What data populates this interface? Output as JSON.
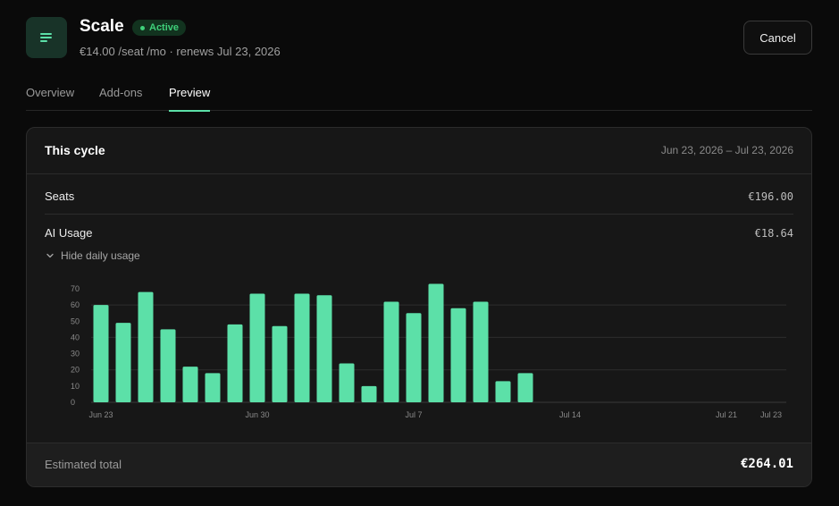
{
  "header": {
    "plan_name": "Scale",
    "status": "Active",
    "subtitle": "€14.00 /seat /mo · renews Jul 23, 2026",
    "cancel_label": "Cancel",
    "icon": "list-lines-icon"
  },
  "tabs": [
    {
      "label": "Overview",
      "active": false
    },
    {
      "label": "Add-ons",
      "active": false
    },
    {
      "label": "Preview",
      "active": true
    }
  ],
  "cycle": {
    "title": "This cycle",
    "range": "Jun 23, 2026 – Jul 23, 2026",
    "rows": [
      {
        "label": "Seats",
        "value": "€196.00"
      },
      {
        "label": "AI Usage",
        "value": "€18.64"
      }
    ],
    "toggle_label": "Hide daily usage",
    "estimated_label": "Estimated total",
    "estimated_value": "€264.01"
  },
  "colors": {
    "accent": "#5ce0a8",
    "badge_bg": "#12331f",
    "badge_text": "#3fd07a",
    "card_bg": "#171717"
  },
  "chart_data": {
    "type": "bar",
    "x_tick_labels": [
      "Jun 23",
      "Jun 30",
      "Jul 7",
      "Jul 14",
      "Jul 21",
      "Jul 23"
    ],
    "y_ticks": [
      0,
      10,
      20,
      30,
      40,
      50,
      60,
      70
    ],
    "ylim": [
      0,
      70
    ],
    "grid": true,
    "days": [
      "Jun 23",
      "Jun 24",
      "Jun 25",
      "Jun 26",
      "Jun 27",
      "Jun 28",
      "Jun 29",
      "Jun 30",
      "Jul 1",
      "Jul 2",
      "Jul 3",
      "Jul 4",
      "Jul 5",
      "Jul 6",
      "Jul 7",
      "Jul 8",
      "Jul 9",
      "Jul 10",
      "Jul 11",
      "Jul 12",
      "Jul 13",
      "Jul 14",
      "Jul 15",
      "Jul 16",
      "Jul 17",
      "Jul 18",
      "Jul 19",
      "Jul 20",
      "Jul 21",
      "Jul 22",
      "Jul 23"
    ],
    "values": [
      60,
      49,
      68,
      45,
      22,
      18,
      48,
      67,
      47,
      67,
      66,
      24,
      10,
      62,
      55,
      73,
      58,
      62,
      13,
      18,
      null,
      null,
      null,
      null,
      null,
      null,
      null,
      null,
      null,
      null,
      null
    ]
  }
}
